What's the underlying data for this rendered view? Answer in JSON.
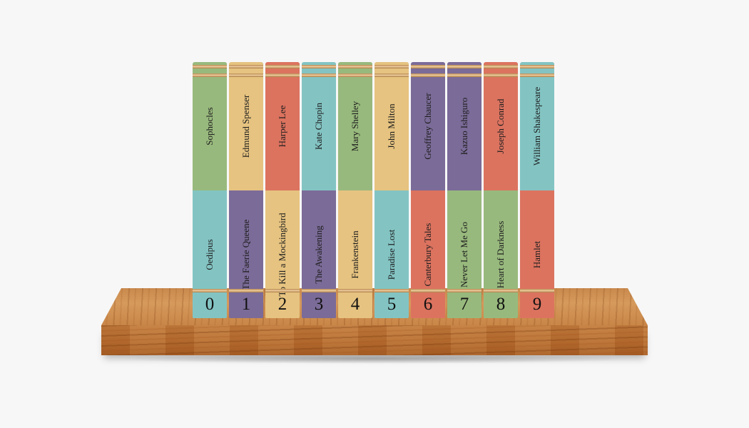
{
  "books": [
    {
      "index": "0",
      "author": "Sophocles",
      "title": "Oedipus",
      "top_color": "#98b97d",
      "bottom_color": "#83c4c3"
    },
    {
      "index": "1",
      "author": "Edmund Spenser",
      "title": "The Faerie Queene",
      "top_color": "#e6c380",
      "bottom_color": "#7b6b98"
    },
    {
      "index": "2",
      "author": "Harper Lee",
      "title": "To Kill a Mockingbird",
      "top_color": "#dc735f",
      "bottom_color": "#e6c380"
    },
    {
      "index": "3",
      "author": "Kate Chopin",
      "title": "The Awakening",
      "top_color": "#83c4c3",
      "bottom_color": "#7b6b98"
    },
    {
      "index": "4",
      "author": "Mary Shelley",
      "title": "Frankenstein",
      "top_color": "#98b97d",
      "bottom_color": "#e6c380"
    },
    {
      "index": "5",
      "author": "John Milton",
      "title": "Paradise Lost",
      "top_color": "#e6c380",
      "bottom_color": "#83c4c3"
    },
    {
      "index": "6",
      "author": "Geoffrey Chaucer",
      "title": "Canterbury Tales",
      "top_color": "#7b6b98",
      "bottom_color": "#dc735f"
    },
    {
      "index": "7",
      "author": "Kazuo Ishiguro",
      "title": "Never Let Me Go",
      "top_color": "#7b6b98",
      "bottom_color": "#98b97d"
    },
    {
      "index": "8",
      "author": "Joseph Conrad",
      "title": "Heart of Darkness",
      "top_color": "#dc735f",
      "bottom_color": "#98b97d"
    },
    {
      "index": "9",
      "author": "William Shakespeare",
      "title": "Hamlet",
      "top_color": "#83c4c3",
      "bottom_color": "#dc735f"
    }
  ]
}
